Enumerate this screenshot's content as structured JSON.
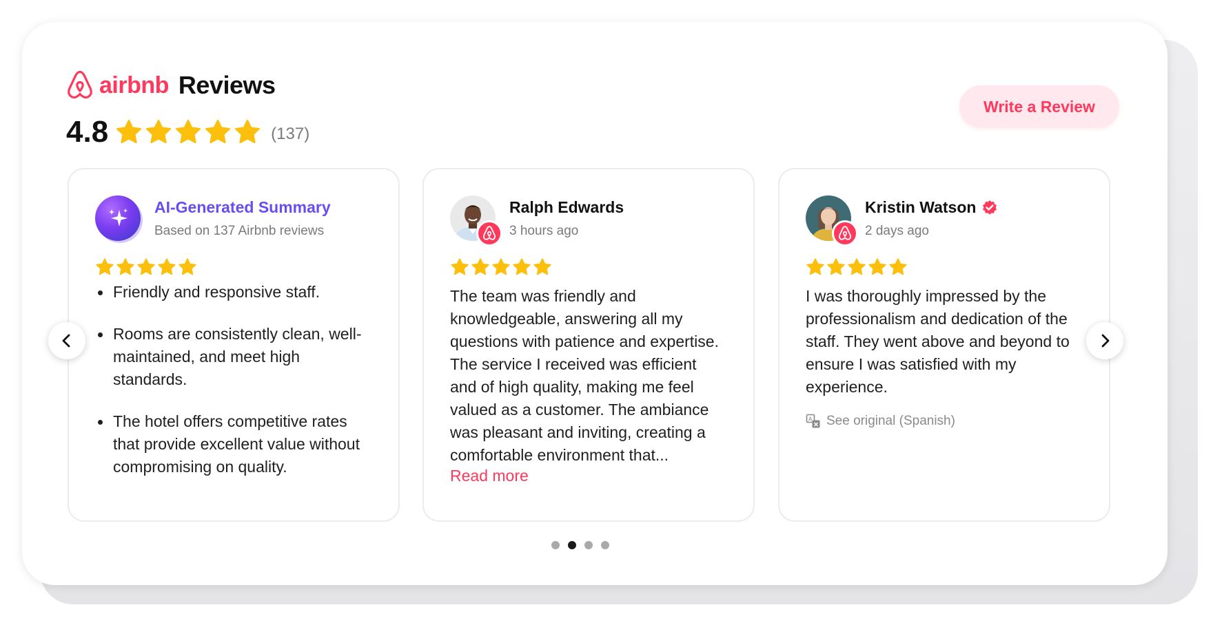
{
  "brand": {
    "name": "airbnb",
    "title": "Reviews",
    "color": "#ff385c"
  },
  "rating": {
    "value": "4.8",
    "stars": 5,
    "count": "(137)"
  },
  "actions": {
    "write_review": "Write a Review"
  },
  "cards": [
    {
      "title": "AI-Generated Summary",
      "subtitle": "Based on 137 Airbnb reviews",
      "stars": 5,
      "bullets": [
        "Friendly and responsive staff.",
        "Rooms are consistently clean, well-maintained, and meet high standards.",
        "The hotel offers competitive rates that provide excellent value without compromising on quality."
      ]
    },
    {
      "name": "Ralph Edwards",
      "time": "3 hours ago",
      "stars": 5,
      "text": "The team was friendly and knowledgeable, answering all my questions with patience and expertise. The service I received was efficient and of high quality, making me feel valued as a customer. The ambiance was pleasant and inviting, creating a comfortable environment that...",
      "read_more": "Read more"
    },
    {
      "name": "Kristin Watson",
      "verified": true,
      "time": "2 days ago",
      "stars": 5,
      "text": "I was thoroughly impressed by the professionalism and dedication of the staff. They went above and beyond to ensure I was satisfied with my experience.",
      "see_original": "See original (Spanish)"
    }
  ],
  "pagination": {
    "total": 4,
    "active_index": 1
  },
  "colors": {
    "star": "#fbbf0c",
    "accent": "#ff385c",
    "ai_title": "#6a4cf5"
  }
}
